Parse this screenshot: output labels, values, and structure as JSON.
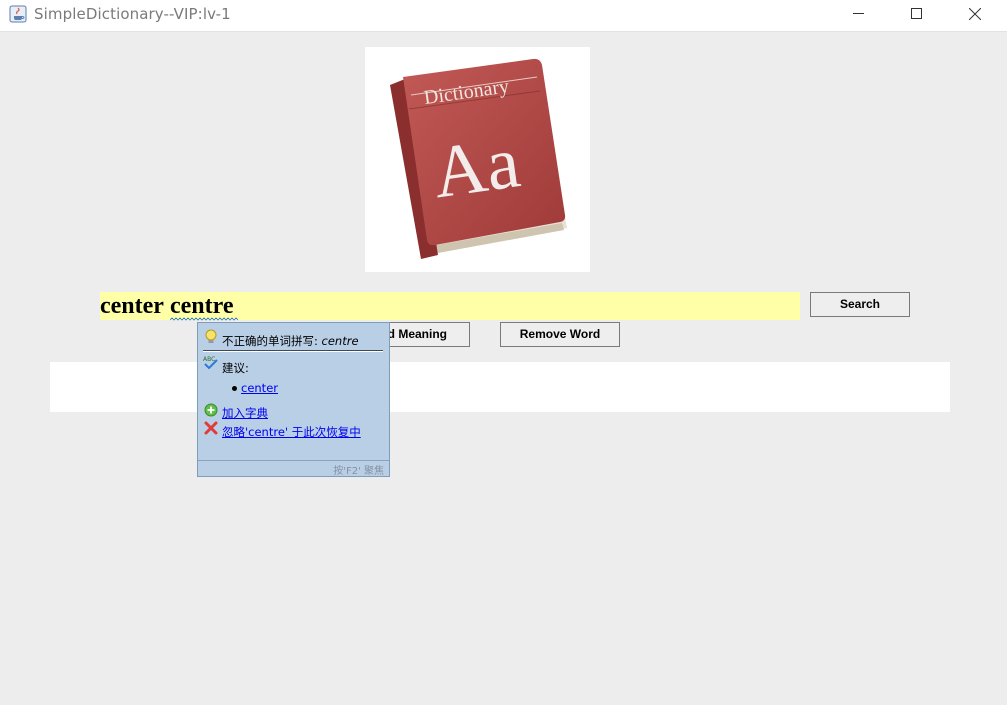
{
  "window": {
    "title": "SimpleDictionary--VIP:lv-1",
    "controls": [
      "minimize-icon",
      "maximize-icon",
      "close-icon"
    ]
  },
  "logo": {
    "text_top": "Dictionary",
    "text_main": "Aa",
    "colors": {
      "cover": "#b94a48",
      "pages": "#f2ece2"
    }
  },
  "input": {
    "word1": "center",
    "word2": "centre",
    "background": "#ffffa8"
  },
  "buttons": {
    "search": "Search",
    "add": "d Meaning",
    "remove": "Remove Word"
  },
  "spell_popup": {
    "header_prefix": "不正确的单词拼写: ",
    "header_word": "centre",
    "suggestions_label": "建议:",
    "suggestions": [
      "center"
    ],
    "add_to_dict": "加入字典",
    "ignore": "忽略'centre' 于此次恢复中",
    "footer": "按'F2' 聚焦",
    "icons": [
      "bulb-icon",
      "spellcheck-icon",
      "add-icon",
      "ignore-icon"
    ]
  }
}
